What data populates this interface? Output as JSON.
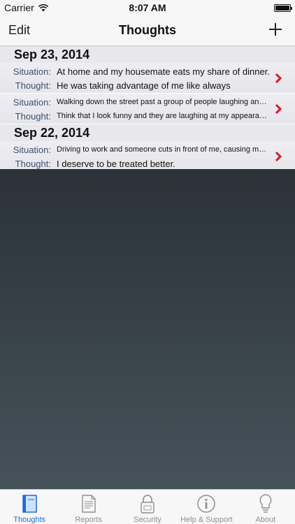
{
  "status": {
    "carrier": "Carrier",
    "time": "8:07 AM"
  },
  "nav": {
    "edit_label": "Edit",
    "title": "Thoughts",
    "add_icon": "plus-icon"
  },
  "labels": {
    "situation": "Situation:",
    "thought": "Thought:"
  },
  "sections": [
    {
      "date": "Sep 23, 2014",
      "rows": [
        {
          "situation": "At home and my housemate eats my share of dinner.",
          "thought": "He was taking advantage of me like always"
        },
        {
          "situation": "Walking down the street past a group of people laughing and hav…",
          "thought": "Think that I look funny and they are laughing at my appearance."
        }
      ]
    },
    {
      "date": "Sep 22, 2014",
      "rows": [
        {
          "situation": "Driving to work and someone cuts in front of me, causing me to s…",
          "thought": "I deserve to be treated better."
        }
      ]
    }
  ],
  "tabs": [
    {
      "label": "Thoughts",
      "icon": "book-icon",
      "active": true
    },
    {
      "label": "Reports",
      "icon": "document-icon",
      "active": false
    },
    {
      "label": "Security",
      "icon": "lock-icon",
      "active": false
    },
    {
      "label": "Help & Support",
      "icon": "info-icon",
      "active": false
    },
    {
      "label": "About",
      "icon": "lightbulb-icon",
      "active": false
    }
  ],
  "colors": {
    "accent": "#1b6fd9",
    "chevron": "#e0161d",
    "label": "#3c4f73"
  }
}
